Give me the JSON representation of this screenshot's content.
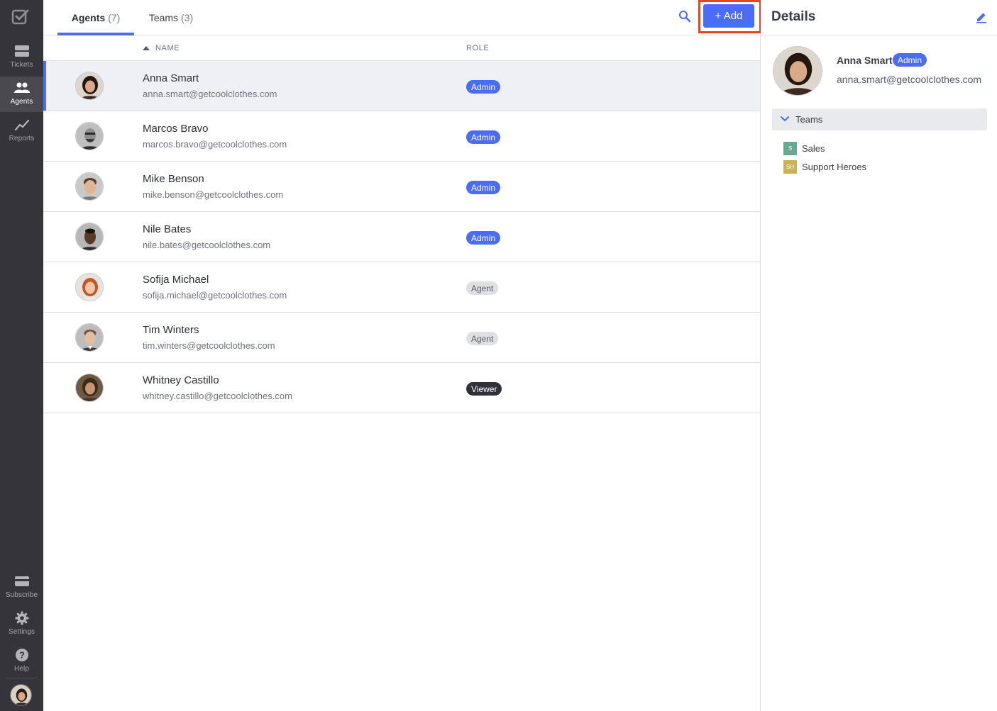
{
  "sidebar": {
    "logo": "checkbox-logo",
    "items": [
      {
        "label": "Tickets",
        "icon": "tickets-icon"
      },
      {
        "label": "Agents",
        "icon": "agents-icon",
        "active": true
      },
      {
        "label": "Reports",
        "icon": "reports-icon"
      }
    ],
    "bottom_items": [
      {
        "label": "Subscribe",
        "icon": "credit-card-icon"
      },
      {
        "label": "Settings",
        "icon": "gear-icon"
      },
      {
        "label": "Help",
        "icon": "help-icon"
      }
    ]
  },
  "header": {
    "tabs": [
      {
        "label": "Agents",
        "count": "(7)",
        "active": true
      },
      {
        "label": "Teams",
        "count": "(3)",
        "active": false
      }
    ],
    "add_label": "+ Add"
  },
  "table": {
    "columns": {
      "name": "NAME",
      "role": "ROLE"
    },
    "rows": [
      {
        "name": "Anna Smart",
        "email": "anna.smart@getcoolclothes.com",
        "role": "Admin",
        "selected": true
      },
      {
        "name": "Marcos Bravo",
        "email": "marcos.bravo@getcoolclothes.com",
        "role": "Admin"
      },
      {
        "name": "Mike Benson",
        "email": "mike.benson@getcoolclothes.com",
        "role": "Admin"
      },
      {
        "name": "Nile Bates",
        "email": "nile.bates@getcoolclothes.com",
        "role": "Admin"
      },
      {
        "name": "Sofija Michael",
        "email": "sofija.michael@getcoolclothes.com",
        "role": "Agent"
      },
      {
        "name": "Tim Winters",
        "email": "tim.winters@getcoolclothes.com",
        "role": "Agent"
      },
      {
        "name": "Whitney Castillo",
        "email": "whitney.castillo@getcoolclothes.com",
        "role": "Viewer"
      }
    ]
  },
  "details": {
    "title": "Details",
    "name": "Anna Smart",
    "role": "Admin",
    "email": "anna.smart@getcoolclothes.com",
    "teams_label": "Teams",
    "teams": [
      {
        "initials": "S",
        "name": "Sales",
        "color": "#6aa892"
      },
      {
        "initials": "SH",
        "name": "Support Heroes",
        "color": "#c9b35a"
      }
    ]
  },
  "colors": {
    "accent": "#4a6cf7",
    "sidebar_bg": "#35343a",
    "highlight": "#e8451c"
  }
}
